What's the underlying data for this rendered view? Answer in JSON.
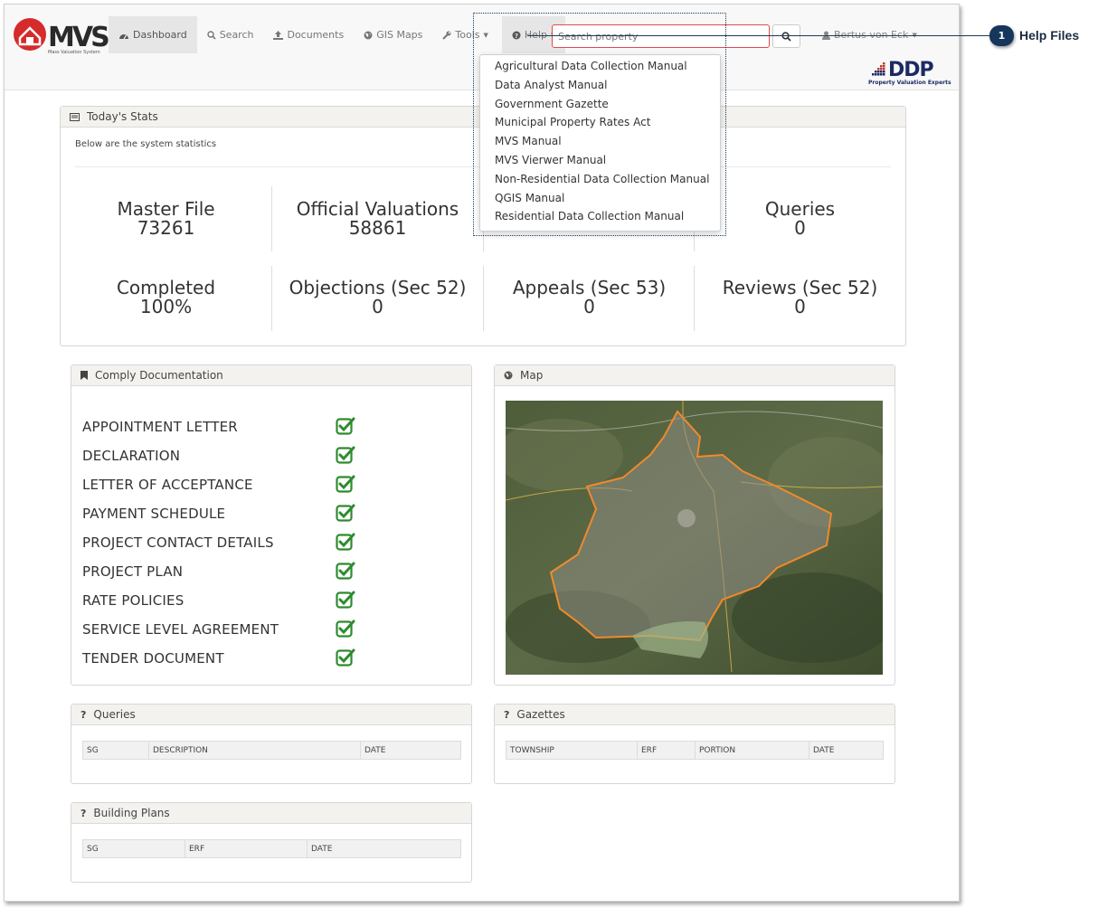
{
  "brand": {
    "logo_text": "MVS",
    "logo_tag": "Mass Valuation System",
    "partner_logo": "DDP",
    "partner_tag": "Property Valuation Experts"
  },
  "nav": [
    {
      "label": "Dashboard",
      "icon": "dashboard-icon"
    },
    {
      "label": "Search",
      "icon": "search-icon"
    },
    {
      "label": "Documents",
      "icon": "upload-icon"
    },
    {
      "label": "GIS Maps",
      "icon": "globe-icon"
    },
    {
      "label": "Tools",
      "icon": "wrench-icon"
    },
    {
      "label": "Help",
      "icon": "question-circle-icon"
    }
  ],
  "search": {
    "placeholder": "Search property"
  },
  "user": {
    "name": "Bertus von Eck"
  },
  "help_menu": [
    "Agricultural Data Collection Manual",
    "Data Analyst Manual",
    "Government Gazette",
    "Municipal Property Rates Act",
    "MVS Manual",
    "MVS Vierwer Manual",
    "Non-Residential Data Collection Manual",
    "QGIS Manual",
    "Residential Data Collection Manual"
  ],
  "stats": {
    "title": "Today's Stats",
    "description": "Below are the system statistics",
    "items": [
      {
        "label": "Master File",
        "value": "73261"
      },
      {
        "label": "Official Valuations",
        "value": "58861"
      },
      {
        "label": "Queries",
        "value": "0"
      },
      {
        "label": "Completed",
        "value": "100%"
      },
      {
        "label": "Objections (Sec 52)",
        "value": "0"
      },
      {
        "label": "Appeals (Sec 53)",
        "value": "0"
      },
      {
        "label": "Reviews (Sec 52)",
        "value": "0"
      }
    ]
  },
  "comply": {
    "title": "Comply Documentation",
    "items": [
      "APPOINTMENT LETTER",
      "DECLARATION",
      "LETTER OF ACCEPTANCE",
      "PAYMENT SCHEDULE",
      "PROJECT CONTACT DETAILS",
      "PROJECT PLAN",
      "RATE POLICIES",
      "SERVICE LEVEL AGREEMENT",
      "TENDER DOCUMENT"
    ]
  },
  "map": {
    "title": "Map"
  },
  "queries": {
    "title": "Queries",
    "columns": [
      "SG",
      "DESCRIPTION",
      "DATE"
    ]
  },
  "gazettes": {
    "title": "Gazettes",
    "columns": [
      "TOWNSHIP",
      "ERF",
      "PORTION",
      "DATE"
    ]
  },
  "building_plans": {
    "title": "Building Plans",
    "columns": [
      "SG",
      "ERF",
      "DATE"
    ]
  },
  "callout": {
    "number": "1",
    "label": "Help Files"
  },
  "colors": {
    "accent_red": "#e04b4b",
    "check_green": "#2e8b2e",
    "callout_navy": "#16365b"
  }
}
